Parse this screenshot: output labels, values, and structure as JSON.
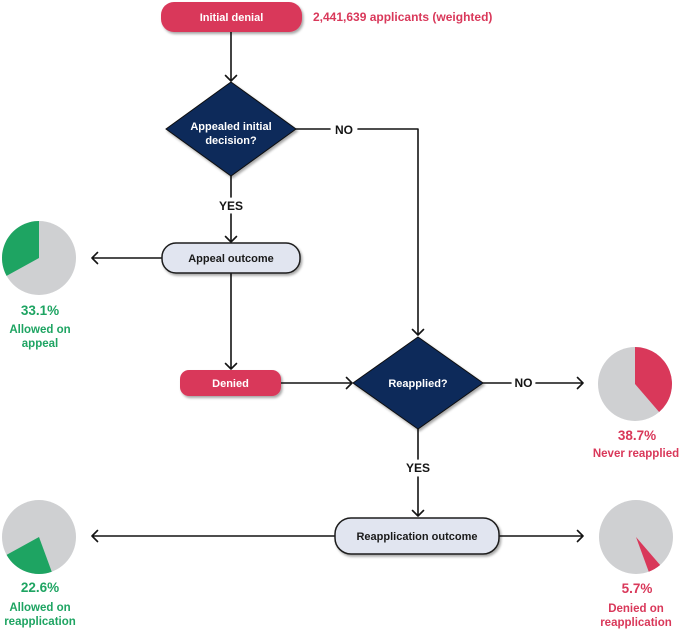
{
  "flowchart": {
    "start": {
      "label": "Initial denial",
      "annotation": "2,441,639 applicants (weighted)"
    },
    "decisions": [
      {
        "label_lines": [
          "Appealed initial",
          "decision?"
        ],
        "no_label": "NO",
        "yes_label": "YES"
      },
      {
        "label_lines": [
          "Reapplied?"
        ],
        "no_label": "NO",
        "yes_label": "YES"
      }
    ],
    "steps": {
      "appeal_outcome": "Appeal outcome",
      "denied": "Denied",
      "reapplication_outcome": "Reapplication outcome"
    }
  },
  "outcomes": [
    {
      "id": "allowed-on-appeal",
      "percent": 33.1,
      "percent_label": "33.1%",
      "label_lines": [
        "Allowed on",
        "appeal"
      ],
      "color": "#1ea462"
    },
    {
      "id": "never-reapplied",
      "percent": 38.7,
      "percent_label": "38.7%",
      "label_lines": [
        "Never reapplied"
      ],
      "color": "#d9385a"
    },
    {
      "id": "allowed-on-reapplication",
      "percent": 22.6,
      "percent_label": "22.6%",
      "label_lines": [
        "Allowed on",
        "reapplication"
      ],
      "color": "#1ea462"
    },
    {
      "id": "denied-on-reapplication",
      "percent": 5.7,
      "percent_label": "5.7%",
      "label_lines": [
        "Denied on",
        "reapplication"
      ],
      "color": "#d9385a"
    }
  ],
  "colors": {
    "denial": "#d9385a",
    "decision": "#0c2a5a",
    "allowed": "#1ea462",
    "pie_remainder": "#cfd0d2",
    "outcome_box": "#e1e5f0"
  }
}
